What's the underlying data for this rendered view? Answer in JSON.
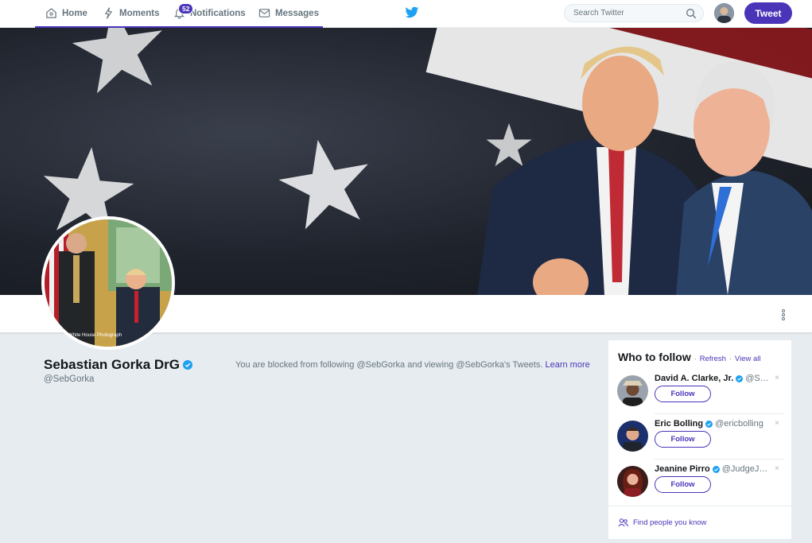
{
  "nav": {
    "items": [
      {
        "label": "Home",
        "icon": "home-icon"
      },
      {
        "label": "Moments",
        "icon": "lightning-icon"
      },
      {
        "label": "Notifications",
        "icon": "bell-icon"
      },
      {
        "label": "Messages",
        "icon": "envelope-icon"
      }
    ],
    "notification_count": "52",
    "search_placeholder": "Search Twitter",
    "tweet_label": "Tweet"
  },
  "profile": {
    "name": "Sebastian Gorka DrG",
    "handle": "@SebGorka",
    "blocked_text": "You are blocked from following @SebGorka and viewing @SebGorka's Tweets.",
    "learn_more": "Learn more",
    "avatar_caption": "White House Photograph"
  },
  "who_to_follow": {
    "title": "Who to follow",
    "separator": "·",
    "refresh": "Refresh",
    "view_all": "View all",
    "close": "×",
    "accounts": [
      {
        "name": "David A. Clarke, Jr.",
        "handle": "@S…",
        "follow": "Follow"
      },
      {
        "name": "Eric Bolling",
        "handle": "@ericbolling",
        "follow": "Follow"
      },
      {
        "name": "Jeanine Pirro",
        "handle": "@JudgeJ…",
        "follow": "Follow"
      }
    ],
    "find_people": "Find people you know"
  },
  "colors": {
    "accent": "#4a34b8",
    "verified": "#1da1f2",
    "background": "#e6ecf0"
  }
}
